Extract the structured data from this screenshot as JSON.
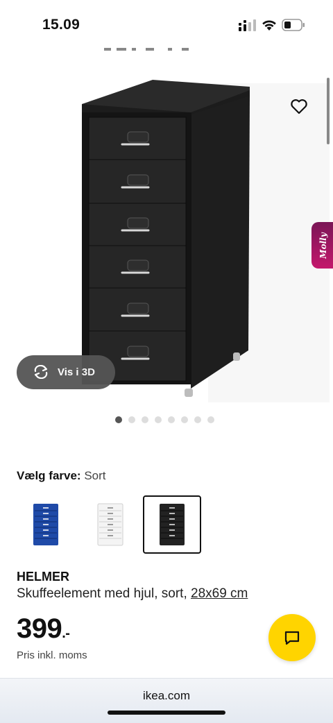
{
  "status_bar": {
    "time": "15.09"
  },
  "product": {
    "name": "HELMER",
    "description": "Skuffeelement med hjul, sort, ",
    "size_link": "28x69 cm",
    "price": "399",
    "price_suffix": ".-",
    "price_note": "Pris inkl. moms",
    "color": "#222222"
  },
  "gallery": {
    "view3d_label": "Vis i 3D",
    "dot_count": 8,
    "active_dot": 1
  },
  "color_selector": {
    "label": "Vælg farve:",
    "selected": "Sort",
    "options": [
      {
        "name": "Blå",
        "color": "#1f4aa8"
      },
      {
        "name": "Hvid",
        "color": "#f4f4f4"
      },
      {
        "name": "Sort",
        "color": "#222222"
      }
    ]
  },
  "assistant": {
    "label": "Molly"
  },
  "browser": {
    "url": "ikea.com"
  },
  "colors": {
    "chat_button": "#ffd400",
    "molly": "#c4176c"
  },
  "icons": [
    "heart-icon",
    "rotate-3d-icon",
    "chat-icon",
    "signal-icon",
    "wifi-icon",
    "battery-icon"
  ]
}
